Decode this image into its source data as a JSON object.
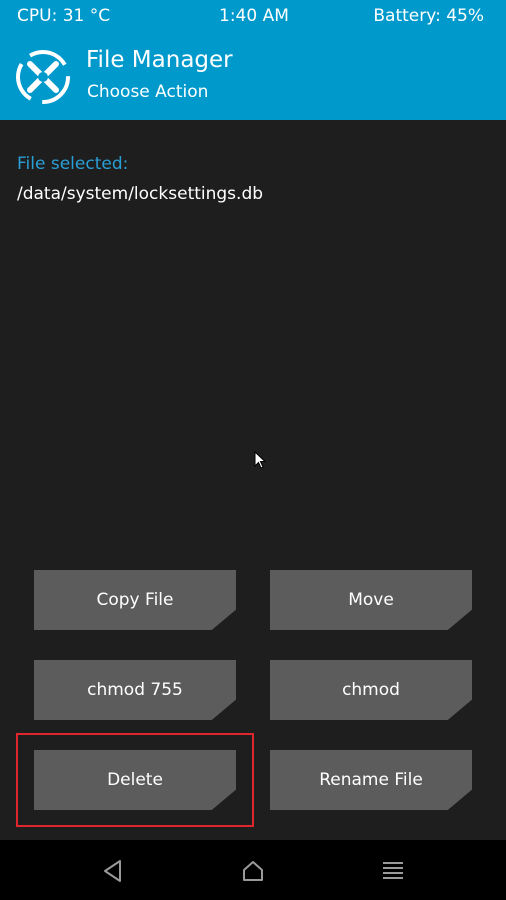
{
  "status": {
    "cpu": "CPU: 31 °C",
    "time": "1:40 AM",
    "battery": "Battery: 45%"
  },
  "header": {
    "title": "File Manager",
    "subtitle": "Choose Action",
    "logo_icon": "twrp-logo-icon"
  },
  "file": {
    "label": "File selected:",
    "path": "/data/system/locksettings.db"
  },
  "actions": {
    "copy": "Copy File",
    "move": "Move",
    "chmod755": "chmod 755",
    "chmod": "chmod",
    "delete": "Delete",
    "rename": "Rename File"
  },
  "nav": {
    "back_icon": "back-icon",
    "home_icon": "home-icon",
    "menu_icon": "menu-icon"
  },
  "colors": {
    "accent": "#0099cc",
    "label_blue": "#2a9fd6",
    "background": "#1e1e1e",
    "button": "#5c5c5c",
    "highlight": "#e0262d"
  }
}
